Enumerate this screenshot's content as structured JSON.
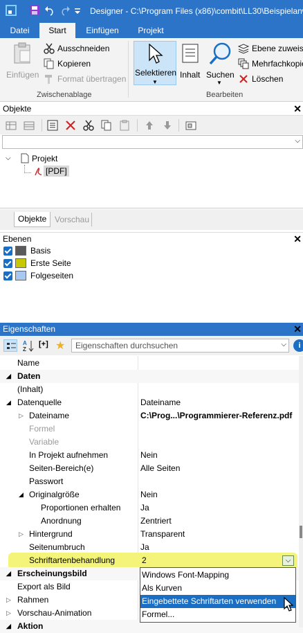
{
  "titlebar": {
    "title": "Designer - C:\\Program Files (x86)\\combit\\LL30\\Beispielanw"
  },
  "ribbon": {
    "tabs": [
      "Datei",
      "Start",
      "Einfügen",
      "Projekt"
    ],
    "einfuegen_label": "Einfügen",
    "ausschneiden_label": "Ausschneiden",
    "kopieren_label": "Kopieren",
    "format_label": "Format übertragen",
    "group1_label": "Zwischenablage",
    "selektieren_label": "Selektieren",
    "inhalt_label": "Inhalt",
    "suchen_label": "Suchen",
    "ebene_label": "Ebene zuweise",
    "mehrfach_label": "Mehrfachkopie",
    "loeschen_label": "Löschen",
    "group2_label": "Bearbeiten"
  },
  "objekte": {
    "title": "Objekte",
    "tree_root": "Projekt",
    "tree_child": "[PDF]",
    "tab_objekte": "Objekte",
    "tab_vorschau": "Vorschau"
  },
  "ebenen": {
    "title": "Ebenen",
    "items": [
      {
        "label": "Basis",
        "color": "#5a5a5a"
      },
      {
        "label": "Erste Seite",
        "color": "#c8c800"
      },
      {
        "label": "Folgeseiten",
        "color": "#a8c8f0"
      }
    ]
  },
  "eigenschaften": {
    "title": "Eigenschaften",
    "search_placeholder": "Eigenschaften durchsuchen",
    "rows": [
      {
        "name": "Name",
        "value": ""
      },
      {
        "name": "Daten",
        "value": ""
      },
      {
        "name": "(Inhalt)",
        "value": ""
      },
      {
        "name": "Datenquelle",
        "value": "Dateiname"
      },
      {
        "name": "Dateiname",
        "value": "C:\\Prog...\\Programmierer-Referenz.pdf"
      },
      {
        "name": "Formel",
        "value": ""
      },
      {
        "name": "Variable",
        "value": ""
      },
      {
        "name": "In Projekt aufnehmen",
        "value": "Nein"
      },
      {
        "name": "Seiten-Bereich(e)",
        "value": "Alle Seiten"
      },
      {
        "name": "Passwort",
        "value": ""
      },
      {
        "name": "Originalgröße",
        "value": "Nein"
      },
      {
        "name": "Proportionen erhalten",
        "value": "Ja"
      },
      {
        "name": "Anordnung",
        "value": "Zentriert"
      },
      {
        "name": "Hintergrund",
        "value": "Transparent"
      },
      {
        "name": "Seitenumbruch",
        "value": "Ja"
      },
      {
        "name": "Schriftartenbehandlung",
        "value": "2"
      },
      {
        "name": "Erscheinungsbild",
        "value": ""
      },
      {
        "name": "Export als Bild",
        "value": ""
      },
      {
        "name": "Rahmen",
        "value": ""
      },
      {
        "name": "Vorschau-Animation",
        "value": ""
      },
      {
        "name": "Aktion",
        "value": ""
      }
    ],
    "dropdown_options": [
      "Windows Font-Mapping",
      "Als Kurven",
      "Eingebettete Schriftarten verwenden",
      "Formel..."
    ]
  }
}
